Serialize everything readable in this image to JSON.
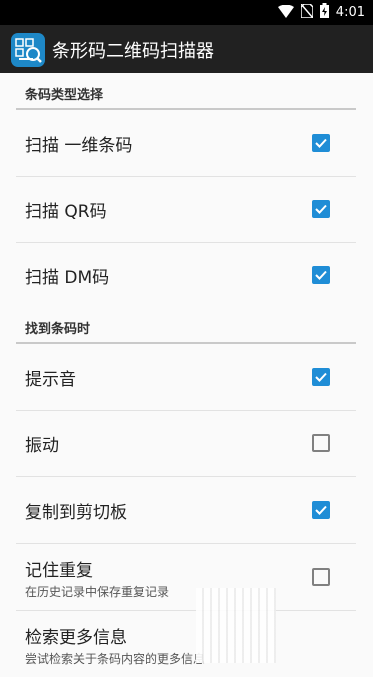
{
  "status_bar": {
    "time": "4:01",
    "icons": [
      "wifi-icon",
      "no-sim-icon",
      "battery-icon"
    ]
  },
  "app_bar": {
    "title": "条形码二维码扫描器",
    "icon": "barcode-scanner-app-icon",
    "color": "#212121"
  },
  "sections": [
    {
      "header": "条码类型选择",
      "items": [
        {
          "title": "扫描 一维条码",
          "checked": true
        },
        {
          "title": "扫描 QR码",
          "checked": true
        },
        {
          "title": "扫描 DM码",
          "checked": true
        }
      ]
    },
    {
      "header": "找到条码时",
      "items": [
        {
          "title": "提示音",
          "checked": true
        },
        {
          "title": "振动",
          "checked": false
        },
        {
          "title": "复制到剪切板",
          "checked": true
        },
        {
          "title": "记住重复",
          "summary": "在历史记录中保存重复记录",
          "checked": false
        },
        {
          "title": "检索更多信息",
          "summary": "尝试检索关于条码内容的更多信息"
        }
      ]
    }
  ],
  "colors": {
    "accent": "#1f8dd6",
    "background": "#fafafa"
  }
}
